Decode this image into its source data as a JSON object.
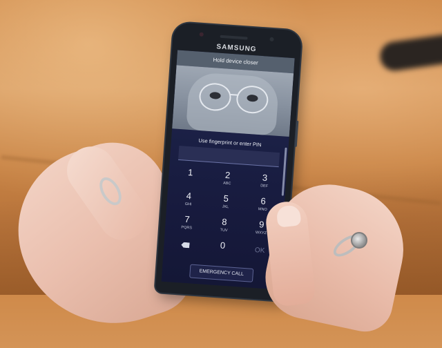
{
  "scene": {
    "background": "wooden-table",
    "colors": {
      "table": "#cf8a4a",
      "skin": "#eabfae",
      "phone_body": "#1b1f26",
      "screen": "#1a1f44",
      "hint_bar": "#55606e"
    }
  },
  "phone": {
    "brand": "SAMSUNG",
    "screen": {
      "hint": "Hold device closer",
      "prompt": "Use fingerprint or enter PIN",
      "pin_value": "",
      "keypad": {
        "k1": {
          "digit": "1",
          "letters": ""
        },
        "k2": {
          "digit": "2",
          "letters": "ABC"
        },
        "k3": {
          "digit": "3",
          "letters": "DEF"
        },
        "k4": {
          "digit": "4",
          "letters": "GHI"
        },
        "k5": {
          "digit": "5",
          "letters": "JKL"
        },
        "k6": {
          "digit": "6",
          "letters": "MNO"
        },
        "k7": {
          "digit": "7",
          "letters": "PQRS"
        },
        "k8": {
          "digit": "8",
          "letters": "TUV"
        },
        "k9": {
          "digit": "9",
          "letters": "WXYZ"
        },
        "k0": {
          "digit": "0",
          "letters": ""
        },
        "backspace_icon": "backspace-icon",
        "ok": "OK"
      },
      "emergency_call": "EMERGENCY CALL"
    }
  }
}
